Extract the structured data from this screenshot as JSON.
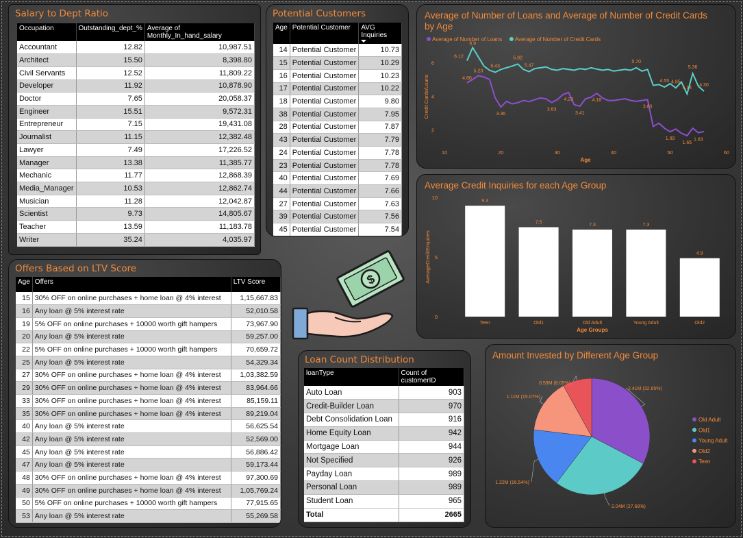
{
  "salary_panel": {
    "title": "Salary to Dept Ratio",
    "headers": [
      "Occupation",
      "Outstanding_dept_%",
      "Average of Monthly_In_hand_salary"
    ],
    "rows": [
      [
        "Accountant",
        "12.82",
        "10,987.51"
      ],
      [
        "Architect",
        "15.50",
        "8,398.80"
      ],
      [
        "Civil Servants",
        "12.52",
        "11,809.22"
      ],
      [
        "Developer",
        "11.92",
        "10,878.90"
      ],
      [
        "Doctor",
        "7.65",
        "20,058.37"
      ],
      [
        "Engineer",
        "15.51",
        "9,572.31"
      ],
      [
        "Entrepreneur",
        "7.15",
        "19,431.08"
      ],
      [
        "Journalist",
        "11.15",
        "12,382.48"
      ],
      [
        "Lawyer",
        "7.49",
        "17,226.52"
      ],
      [
        "Manager",
        "13.38",
        "11,385.77"
      ],
      [
        "Mechanic",
        "11.77",
        "12,868.39"
      ],
      [
        "Media_Manager",
        "10.53",
        "12,862.74"
      ],
      [
        "Musician",
        "11.28",
        "12,042.87"
      ],
      [
        "Scientist",
        "9.73",
        "14,805.67"
      ],
      [
        "Teacher",
        "13.59",
        "11,183.78"
      ],
      [
        "Writer",
        "35.24",
        "4,035.97"
      ]
    ]
  },
  "potential_panel": {
    "title": "Potential Customers",
    "headers": [
      "Age",
      "Potential Customer",
      "AVG Inquiries"
    ],
    "rows": [
      [
        "14",
        "Potential Customer",
        "10.73"
      ],
      [
        "15",
        "Potential Customer",
        "10.29"
      ],
      [
        "16",
        "Potential Customer",
        "10.23"
      ],
      [
        "17",
        "Potential Customer",
        "10.22"
      ],
      [
        "18",
        "Potential Customer",
        "9.80"
      ],
      [
        "38",
        "Potential Customer",
        "7.95"
      ],
      [
        "28",
        "Potential Customer",
        "7.87"
      ],
      [
        "43",
        "Potential Customer",
        "7.79"
      ],
      [
        "24",
        "Potential Customer",
        "7.78"
      ],
      [
        "23",
        "Potential Customer",
        "7.78"
      ],
      [
        "40",
        "Potential Customer",
        "7.69"
      ],
      [
        "44",
        "Potential Customer",
        "7.66"
      ],
      [
        "27",
        "Potential Customer",
        "7.63"
      ],
      [
        "39",
        "Potential Customer",
        "7.56"
      ],
      [
        "45",
        "Potential Customer",
        "7.54"
      ]
    ]
  },
  "offers_panel": {
    "title": "Offers Based on LTV Score",
    "headers": [
      "Age",
      "Offers",
      "LTV Score"
    ],
    "rows": [
      [
        "15",
        "30% OFF on online purchases + home loan @ 4% interest",
        "1,15,667.83"
      ],
      [
        "16",
        "Any loan @ 5% interest rate",
        "52,010.58"
      ],
      [
        "19",
        "5% OFF on online purchases + 10000 worth gift hampers",
        "73,967.90"
      ],
      [
        "20",
        "Any loan @ 5% interest rate",
        "59,257.00"
      ],
      [
        "22",
        "5% OFF on online purchases + 10000 worth gift hampers",
        "70,659.72"
      ],
      [
        "25",
        "Any loan @ 5% interest rate",
        "54,329.34"
      ],
      [
        "27",
        "30% OFF on online purchases + home loan @ 4% interest",
        "1,03,382.59"
      ],
      [
        "29",
        "30% OFF on online purchases + home loan @ 4% interest",
        "83,964.66"
      ],
      [
        "33",
        "30% OFF on online purchases + home loan @ 4% interest",
        "85,159.11"
      ],
      [
        "35",
        "30% OFF on online purchases + home loan @ 4% interest",
        "89,219.04"
      ],
      [
        "40",
        "Any loan @ 5% interest rate",
        "56,625.54"
      ],
      [
        "42",
        "Any loan @ 5% interest rate",
        "52,569.00"
      ],
      [
        "45",
        "Any loan @ 5% interest rate",
        "56,886.42"
      ],
      [
        "47",
        "Any loan @ 5% interest rate",
        "59,173.44"
      ],
      [
        "48",
        "30% OFF on online purchases + home loan @ 4% interest",
        "97,300.69"
      ],
      [
        "49",
        "30% OFF on online purchases + home loan @ 4% interest",
        "1,05,769.24"
      ],
      [
        "50",
        "5% OFF on online purchases + 10000 worth gift hampers",
        "77,915.65"
      ],
      [
        "53",
        "Any loan @ 5% interest rate",
        "55,269.58"
      ]
    ]
  },
  "loan_panel": {
    "title": "Loan Count Distribution",
    "headers": [
      "loanType",
      "Count of customerID"
    ],
    "rows": [
      [
        "Auto Loan",
        "903"
      ],
      [
        "Credit-Builder Loan",
        "970"
      ],
      [
        "Debt Consolidation Loan",
        "916"
      ],
      [
        "Home Equity Loan",
        "942"
      ],
      [
        "Mortgage Loan",
        "944"
      ],
      [
        "Not Specified",
        "926"
      ],
      [
        "Payday Loan",
        "989"
      ],
      [
        "Personal Loan",
        "989"
      ],
      [
        "Student Loan",
        "965"
      ]
    ],
    "total": [
      "Total",
      "2665"
    ]
  },
  "colors": {
    "title_orange": "#f28a3a",
    "loans_line": "#8f4ed0",
    "cards_line": "#5ccfc6",
    "pie_old_adult": "#8a4fc9",
    "pie_old1": "#5ccbc8",
    "pie_young_adult": "#4a86f0",
    "pie_old2": "#f7957c",
    "pie_teen": "#e8545a"
  },
  "decor": {
    "illustration": "hand-holding-money-icon"
  },
  "chart_data": [
    {
      "type": "line",
      "title": "Average of Number of Loans and Average of Number of Credit Cards by Age",
      "xlabel": "Age",
      "ylabel": "Credit Cards/Loans",
      "xlim": [
        10,
        60
      ],
      "ylim": [
        1,
        7
      ],
      "x_ticks": [
        "10",
        "20",
        "30",
        "40",
        "50",
        "60"
      ],
      "y_ticks": [
        "2",
        "4",
        "6"
      ],
      "grid": false,
      "legend_position": "top-left",
      "x": [
        14,
        15,
        16,
        17,
        18,
        19,
        20,
        21,
        22,
        23,
        24,
        25,
        26,
        27,
        28,
        29,
        30,
        31,
        32,
        33,
        34,
        35,
        36,
        37,
        38,
        39,
        40,
        41,
        42,
        43,
        44,
        45,
        46,
        47,
        48,
        49,
        50,
        51,
        52,
        53,
        54,
        55,
        56
      ],
      "series": [
        {
          "name": "Average of Number of Loans",
          "values": [
            4.8,
            5.0,
            5.23,
            5.15,
            5.0,
            3.9,
            3.36,
            3.7,
            3.55,
            3.62,
            3.75,
            3.68,
            3.8,
            3.9,
            3.85,
            3.63,
            3.8,
            4.1,
            4.23,
            3.5,
            3.41,
            3.85,
            3.95,
            4.18,
            3.9,
            3.75,
            3.75,
            3.8,
            3.85,
            3.75,
            3.7,
            3.75,
            3.8,
            2.2,
            2.4,
            2.1,
            1.89,
            2.05,
            1.8,
            1.65,
            2.1,
            1.83,
            1.9
          ]
        },
        {
          "name": "Average of Number of Credit Cards",
          "values": [
            6.12,
            6.9,
            6.35,
            5.8,
            5.55,
            5.43,
            5.6,
            5.7,
            5.8,
            5.92,
            5.6,
            5.47,
            5.65,
            5.7,
            5.75,
            5.6,
            5.55,
            5.65,
            5.6,
            5.55,
            5.65,
            5.6,
            5.7,
            5.62,
            5.55,
            5.6,
            5.5,
            5.55,
            5.6,
            5.55,
            5.7,
            5.5,
            5.6,
            4.65,
            4.7,
            4.55,
            4.75,
            4.5,
            4.85,
            4.14,
            5.36,
            4.6,
            4.3
          ]
        }
      ],
      "point_labels": [
        {
          "series": "Average of Number of Loans",
          "x": 14,
          "label": "4.80"
        },
        {
          "series": "Average of Number of Loans",
          "x": 16,
          "label": "5.23"
        },
        {
          "series": "Average of Number of Loans",
          "x": 20,
          "label": "3.36"
        },
        {
          "series": "Average of Number of Loans",
          "x": 29,
          "label": "3.63"
        },
        {
          "series": "Average of Number of Loans",
          "x": 32,
          "label": "4.23"
        },
        {
          "series": "Average of Number of Loans",
          "x": 34,
          "label": "3.41"
        },
        {
          "series": "Average of Number of Loans",
          "x": 37,
          "label": "4.18"
        },
        {
          "series": "Average of Number of Loans",
          "x": 46,
          "label": "3.80"
        },
        {
          "series": "Average of Number of Loans",
          "x": 50,
          "label": "1.89"
        },
        {
          "series": "Average of Number of Loans",
          "x": 53,
          "label": "1.65"
        },
        {
          "series": "Average of Number of Loans",
          "x": 55,
          "label": "1.83"
        },
        {
          "series": "Average of Number of Credit Cards",
          "x": 14,
          "label": "6.12"
        },
        {
          "series": "Average of Number of Credit Cards",
          "x": 15,
          "label": "6.9"
        },
        {
          "series": "Average of Number of Credit Cards",
          "x": 19,
          "label": "5.43"
        },
        {
          "series": "Average of Number of Credit Cards",
          "x": 23,
          "label": "5.92"
        },
        {
          "series": "Average of Number of Credit Cards",
          "x": 25,
          "label": "5.47"
        },
        {
          "series": "Average of Number of Credit Cards",
          "x": 44,
          "label": "5.70"
        },
        {
          "series": "Average of Number of Credit Cards",
          "x": 49,
          "label": "4.55"
        },
        {
          "series": "Average of Number of Credit Cards",
          "x": 51,
          "label": "4.85"
        },
        {
          "series": "Average of Number of Credit Cards",
          "x": 53,
          "label": "4.14"
        },
        {
          "series": "Average of Number of Credit Cards",
          "x": 54,
          "label": "5.36"
        },
        {
          "series": "Average of Number of Credit Cards",
          "x": 56,
          "label": "4.30"
        }
      ]
    },
    {
      "type": "bar",
      "title": "Average Credit Inquiries for each Age Group",
      "xlabel": "Age Groups",
      "ylabel": "AverageCreditEnquires",
      "categories": [
        "Teen",
        "Old1",
        "Old Adult",
        "Young Adult",
        "Old2"
      ],
      "values": [
        9.3,
        7.5,
        7.3,
        7.3,
        4.9
      ],
      "value_labels": [
        "9.3",
        "7.5",
        "7.3",
        "7.3",
        "4.9"
      ],
      "ylim": [
        0,
        10
      ],
      "y_ticks": [
        "0",
        "5",
        "10"
      ],
      "grid": false
    },
    {
      "type": "pie",
      "title": "Amount Invested by Different Age Group",
      "legend_position": "right",
      "slices": [
        {
          "name": "Old Adult",
          "value": 2.41,
          "percent": 32.65,
          "label": "2.41M (32.65%)"
        },
        {
          "name": "Old1",
          "value": 2.04,
          "percent": 27.68,
          "label": "2.04M (27.68%)"
        },
        {
          "name": "Young Adult",
          "value": 1.22,
          "percent": 16.54,
          "label": "1.22M (16.54%)"
        },
        {
          "name": "Old2",
          "value": 1.11,
          "percent": 15.07,
          "label": "1.11M (15.07%)"
        },
        {
          "name": "Teen",
          "value": 0.59,
          "percent": 8.05,
          "label": "0.59M (8.05%)"
        }
      ]
    }
  ]
}
